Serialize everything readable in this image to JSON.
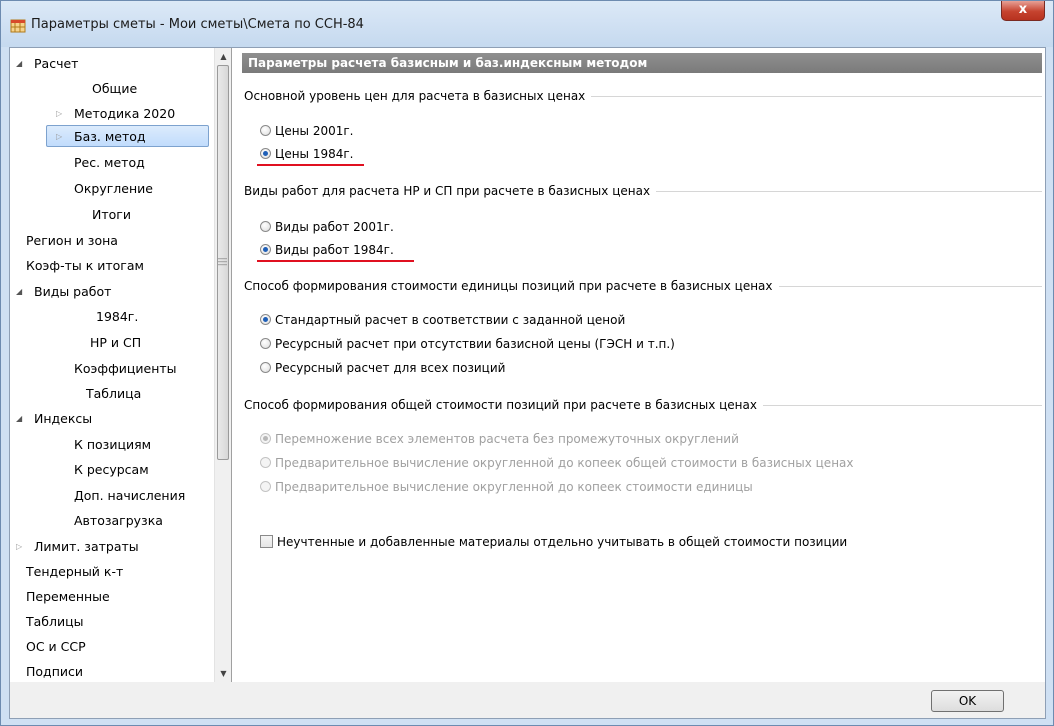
{
  "window": {
    "title": "Параметры сметы - Мои сметы\\Смета по ССН-84",
    "close_label": "x"
  },
  "sidebar": {
    "items": [
      {
        "label": "Расчет",
        "expander": "expanded"
      },
      {
        "label": "Общие"
      },
      {
        "label": "Методика 2020",
        "expander": "collapsed"
      },
      {
        "label": "Баз. метод",
        "expander": "collapsed",
        "selected": true
      },
      {
        "label": "Рес. метод"
      },
      {
        "label": "Округление"
      },
      {
        "label": "Итоги"
      },
      {
        "label": "Регион и зона"
      },
      {
        "label": "Коэф-ты к итогам"
      },
      {
        "label": "Виды работ",
        "expander": "expanded"
      },
      {
        "label": "1984г."
      },
      {
        "label": "НР и СП"
      },
      {
        "label": "Коэффициенты"
      },
      {
        "label": "Таблица"
      },
      {
        "label": "Индексы",
        "expander": "expanded"
      },
      {
        "label": "К позициям"
      },
      {
        "label": "К ресурсам"
      },
      {
        "label": "Доп. начисления"
      },
      {
        "label": "Автозагрузка"
      },
      {
        "label": "Лимит. затраты",
        "expander": "collapsed"
      },
      {
        "label": "Тендерный к-т"
      },
      {
        "label": "Переменные"
      },
      {
        "label": "Таблицы"
      },
      {
        "label": "ОС и ССР"
      },
      {
        "label": "Подписи"
      }
    ]
  },
  "main": {
    "header": "Параметры расчета базисным и баз.индексным методом",
    "groups": [
      {
        "title": "Основной уровень цен для расчета в базисных ценах",
        "options": [
          {
            "label": "Цены 2001г.",
            "checked": false
          },
          {
            "label": "Цены 1984г.",
            "checked": true
          }
        ]
      },
      {
        "title": "Виды работ для расчета НР и СП при расчете в базисных ценах",
        "options": [
          {
            "label": "Виды работ 2001г.",
            "checked": false
          },
          {
            "label": "Виды работ 1984г.",
            "checked": true
          }
        ]
      },
      {
        "title": "Способ формирования стоимости единицы позиций при расчете в базисных ценах",
        "options": [
          {
            "label": "Стандартный расчет в соответствии с заданной ценой",
            "checked": true
          },
          {
            "label": "Ресурсный расчет при отсутствии базисной цены (ГЭСН и т.п.)",
            "checked": false
          },
          {
            "label": "Ресурсный расчет для всех позиций",
            "checked": false
          }
        ]
      },
      {
        "title": "Способ формирования общей стоимости позиций при расчете в базисных ценах",
        "disabled": true,
        "options": [
          {
            "label": "Перемножение всех элементов расчета без промежуточных округлений",
            "checked": true
          },
          {
            "label": "Предварительное вычисление округленной до копеек общей стоимости в базисных ценах",
            "checked": false
          },
          {
            "label": "Предварительное вычисление округленной до копеек стоимости единицы",
            "checked": false
          }
        ]
      }
    ],
    "checkbox": {
      "label": "Неучтенные и добавленные материалы отдельно учитывать в общей стоимости позиции",
      "checked": false
    }
  },
  "footer": {
    "ok_label": "OK"
  },
  "colors": {
    "accent": "#1f5fb7",
    "highlight_underline": "#e01020",
    "header_bar": "#808080"
  }
}
